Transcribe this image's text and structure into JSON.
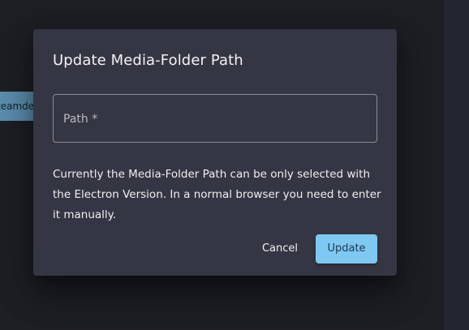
{
  "background": {
    "chip_text": "teamdeck"
  },
  "dialog": {
    "title": "Update Media-Folder Path",
    "path_field": {
      "label": "Path *",
      "value": ""
    },
    "message": "Currently the Media-Folder Path can be only selected with the Electron Version. In a normal browser you need to enter it manually.",
    "cancel_label": "Cancel",
    "update_label": "Update"
  },
  "colors": {
    "dialog_background": "#353643",
    "primary_button": "#7ec8f2",
    "backdrop": "#1e1f25"
  }
}
